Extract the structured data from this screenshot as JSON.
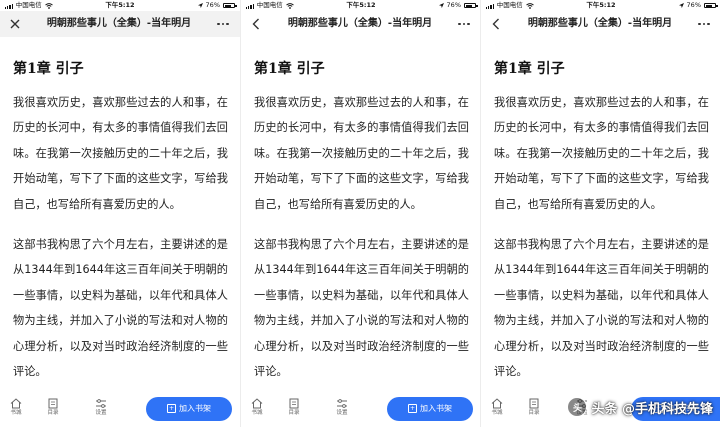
{
  "colors": {
    "accent": "#2f73f6",
    "text": "#222222",
    "navbar_first": "#f2f2f2"
  },
  "panels": [
    {
      "status": {
        "carrier": "中国电信",
        "time": "下午5:12",
        "battery": "76%",
        "battery_level": 0.76
      },
      "nav": {
        "left_icon": "close-icon",
        "title": "明朝那些事儿（全集）-当年明月"
      },
      "chapter": "第1章 引子",
      "paragraphs": [
        "我很喜欢历史，喜欢那些过去的人和事，在历史的长河中，有太多的事情值得我们去回味。在我第一次接触历史的二十年之后，我开始动笔，写下了下面的这些文字，写给我自己，也写给所有喜爱历史的人。",
        "这部书我构思了六个月左右，主要讲述的是从1344年到1644年这三百年间关于明朝的一些事情，以史料为基础，以年代和具体人物为主线，并加入了小说的写法和对人物的心理分析，以及对当时政治经济制度的一些评论。"
      ],
      "tabs": [
        "书城",
        "目录",
        "设置"
      ],
      "shelf_button": "加入书架"
    },
    {
      "status": {
        "carrier": "中国电信",
        "time": "下午5:12",
        "battery": "76%",
        "battery_level": 0.76
      },
      "nav": {
        "left_icon": "back-icon",
        "title": "明朝那些事儿（全集）-当年明月"
      },
      "chapter": "第1章 引子",
      "paragraphs": [
        "我很喜欢历史，喜欢那些过去的人和事，在历史的长河中，有太多的事情值得我们去回味。在我第一次接触历史的二十年之后，我开始动笔，写下了下面的这些文字，写给我自己，也写给所有喜爱历史的人。",
        "这部书我构思了六个月左右，主要讲述的是从1344年到1644年这三百年间关于明朝的一些事情，以史料为基础，以年代和具体人物为主线，并加入了小说的写法和对人物的心理分析，以及对当时政治经济制度的一些评论。"
      ],
      "tabs": [
        "书城",
        "目录",
        "设置"
      ],
      "shelf_button": "加入书架"
    },
    {
      "status": {
        "carrier": "中国电信",
        "time": "下午5:12",
        "battery": "76%",
        "battery_level": 0.76
      },
      "nav": {
        "left_icon": "back-icon",
        "title": "明朝那些事儿（全集）-当年明月"
      },
      "chapter": "第1章 引子",
      "paragraphs": [
        "我很喜欢历史，喜欢那些过去的人和事，在历史的长河中，有太多的事情值得我们去回味。在我第一次接触历史的二十年之后，我开始动笔，写下了下面的这些文字，写给我自己，也写给所有喜爱历史的人。",
        "这部书我构思了六个月左右，主要讲述的是从1344年到1644年这三百年间关于明朝的一些事情，以史料为基础，以年代和具体人物为主线，并加入了小说的写法和对人物的心理分析，以及对当时政治经济制度的一些评论。"
      ],
      "tabs": [
        "书城",
        "目录",
        "设置"
      ],
      "shelf_button": "加入书架"
    }
  ],
  "watermark": {
    "text": "头条 @手机科技先锋",
    "logo_icon": "toutiao-logo-icon"
  }
}
